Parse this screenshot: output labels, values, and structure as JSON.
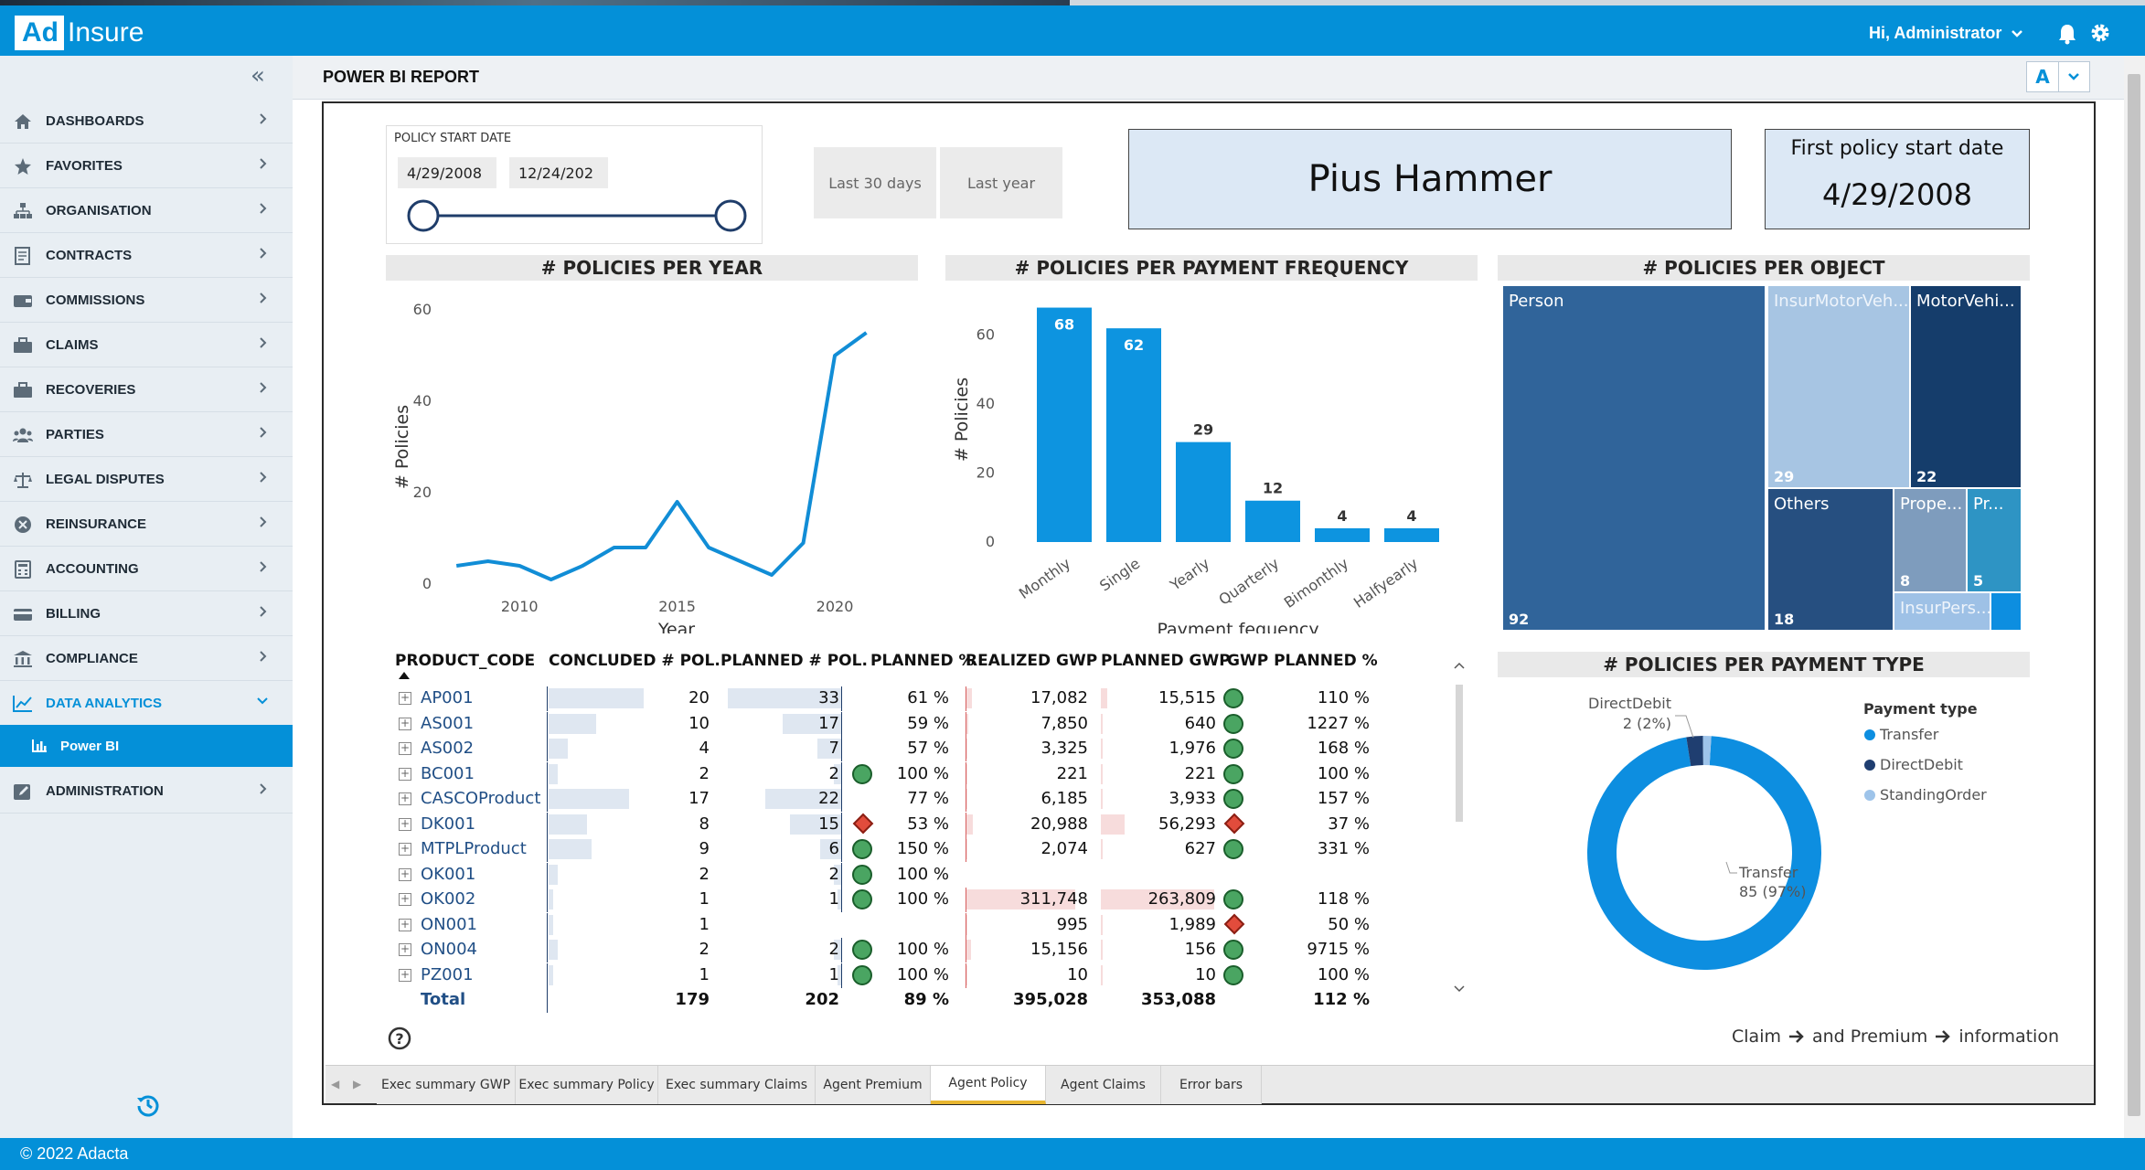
{
  "app": {
    "logo_a": "Ad",
    "logo_b": "Insure",
    "user_greeting": "Hi, Administrator",
    "footer": "© 2022 Adacta"
  },
  "sidebar": {
    "items": [
      {
        "label": "DASHBOARDS",
        "icon": "home-icon"
      },
      {
        "label": "FAVORITES",
        "icon": "star-icon"
      },
      {
        "label": "ORGANISATION",
        "icon": "org-chart-icon"
      },
      {
        "label": "CONTRACTS",
        "icon": "contract-icon"
      },
      {
        "label": "COMMISSIONS",
        "icon": "wallet-icon"
      },
      {
        "label": "CLAIMS",
        "icon": "briefcase-icon"
      },
      {
        "label": "RECOVERIES",
        "icon": "briefcase-icon"
      },
      {
        "label": "PARTIES",
        "icon": "people-icon"
      },
      {
        "label": "LEGAL DISPUTES",
        "icon": "scale-icon"
      },
      {
        "label": "REINSURANCE",
        "icon": "x-circle-icon"
      },
      {
        "label": "ACCOUNTING",
        "icon": "calculator-icon"
      },
      {
        "label": "BILLING",
        "icon": "card-icon"
      },
      {
        "label": "COMPLIANCE",
        "icon": "bank-icon"
      },
      {
        "label": "DATA ANALYTICS",
        "icon": "chart-icon"
      },
      {
        "label": "ADMINISTRATION",
        "icon": "edit-icon"
      }
    ],
    "sub_item": "Power BI"
  },
  "header": {
    "title": "POWER BI REPORT",
    "lang": "A"
  },
  "report": {
    "slicer_title": "POLICY START DATE",
    "date_from": "4/29/2008",
    "date_to": "12/24/202",
    "btn_last30": "Last 30 days",
    "btn_lastyear": "Last year",
    "agent_name": "Pius Hammer",
    "first_policy_label": "First policy start date",
    "first_policy_value": "4/29/2008",
    "footnote_claim": "Claim",
    "footnote_premium": "and Premium",
    "footnote_info": "information",
    "tabs": [
      "Exec summary GWP",
      "Exec summary Policy",
      "Exec summary Claims",
      "Agent Premium",
      "Agent Policy",
      "Agent Claims",
      "Error bars"
    ],
    "active_tab": 4
  },
  "chart_data": [
    {
      "type": "line",
      "title": "# POLICIES PER YEAR",
      "xlabel": "Year",
      "ylabel": "# Policies",
      "x": [
        2008,
        2009,
        2010,
        2011,
        2012,
        2013,
        2014,
        2015,
        2016,
        2017,
        2018,
        2019,
        2020,
        2021
      ],
      "values": [
        4,
        5,
        4,
        1,
        4,
        8,
        8,
        18,
        8,
        5,
        2,
        9,
        50,
        55
      ],
      "xticks": [
        "2010",
        "2015",
        "2020"
      ],
      "yticks": [
        "0",
        "20",
        "40",
        "60"
      ],
      "ylim": [
        0,
        60
      ],
      "xlim": [
        2007.5,
        2022
      ],
      "color": "#118dd6"
    },
    {
      "type": "bar",
      "title": "# POLICIES PER PAYMENT FREQUENCY",
      "xlabel": "Payment fequency",
      "ylabel": "# Policies",
      "categories": [
        "Monthly",
        "Single",
        "Yearly",
        "Quarterly",
        "Bimonthly",
        "Halfyearly"
      ],
      "values": [
        68,
        62,
        29,
        12,
        4,
        4
      ],
      "yticks": [
        "0",
        "20",
        "40",
        "60"
      ],
      "ylim": [
        0,
        70
      ],
      "color": "#0d94e0"
    },
    {
      "type": "treemap",
      "title": "# POLICIES PER OBJECT",
      "items": [
        {
          "name": "Person",
          "value": 92,
          "color": "#30649a"
        },
        {
          "name": "InsurMotorVeh...",
          "value": 29,
          "color": "#a7c5e3"
        },
        {
          "name": "MotorVehi...",
          "value": 22,
          "color": "#153d6b"
        },
        {
          "name": "Others",
          "value": 18,
          "color": "#264f80"
        },
        {
          "name": "Prope...",
          "value": 8,
          "color": "#7e9cbd"
        },
        {
          "name": "Pr...",
          "value": 5,
          "color": "#2e94c4"
        },
        {
          "name": "InsurPers...",
          "value": null,
          "color": "#9ec1e6"
        },
        {
          "name": "",
          "value": null,
          "color": "#0d8ee0"
        }
      ]
    },
    {
      "type": "pie",
      "title": "# POLICIES PER PAYMENT TYPE",
      "legend_title": "Payment type",
      "slices": [
        {
          "name": "Transfer",
          "value": 85,
          "label": "85 (97%)",
          "color": "#0d8ee0"
        },
        {
          "name": "DirectDebit",
          "value": 2,
          "label": "2 (2%)",
          "color": "#1f3e70"
        },
        {
          "name": "StandingOrder",
          "value": 1,
          "label": "",
          "color": "#9ec4ea"
        }
      ]
    },
    {
      "type": "table",
      "columns": [
        "PRODUCT_CODE",
        "CONCLUDED # POL.",
        "PLANNED # POL.",
        "PLANNED %",
        "REALIZED GWP",
        "PLANNED GWP",
        "GWP PLANNED %"
      ],
      "rows": [
        {
          "code": "AP001",
          "concluded": "20",
          "planned": "33",
          "status": "",
          "pct": "61 %",
          "realized": "17,082",
          "pgwp": "15,515",
          "gstatus": "green",
          "gpct": "110 %"
        },
        {
          "code": "AS001",
          "concluded": "10",
          "planned": "17",
          "status": "",
          "pct": "59 %",
          "realized": "7,850",
          "pgwp": "640",
          "gstatus": "green",
          "gpct": "1227 %"
        },
        {
          "code": "AS002",
          "concluded": "4",
          "planned": "7",
          "status": "",
          "pct": "57 %",
          "realized": "3,325",
          "pgwp": "1,976",
          "gstatus": "green",
          "gpct": "168 %"
        },
        {
          "code": "BC001",
          "concluded": "2",
          "planned": "2",
          "status": "green",
          "pct": "100 %",
          "realized": "221",
          "pgwp": "221",
          "gstatus": "green",
          "gpct": "100 %"
        },
        {
          "code": "CASCOProduct",
          "concluded": "17",
          "planned": "22",
          "status": "",
          "pct": "77 %",
          "realized": "6,185",
          "pgwp": "3,933",
          "gstatus": "green",
          "gpct": "157 %"
        },
        {
          "code": "DK001",
          "concluded": "8",
          "planned": "15",
          "status": "red",
          "pct": "53 %",
          "realized": "20,988",
          "pgwp": "56,293",
          "gstatus": "red",
          "gpct": "37 %"
        },
        {
          "code": "MTPLProduct",
          "concluded": "9",
          "planned": "6",
          "status": "green",
          "pct": "150 %",
          "realized": "2,074",
          "pgwp": "627",
          "gstatus": "green",
          "gpct": "331 %"
        },
        {
          "code": "OK001",
          "concluded": "2",
          "planned": "2",
          "status": "green",
          "pct": "100 %",
          "realized": "",
          "pgwp": "",
          "gstatus": "",
          "gpct": ""
        },
        {
          "code": "OK002",
          "concluded": "1",
          "planned": "1",
          "status": "green",
          "pct": "100 %",
          "realized": "311,748",
          "pgwp": "263,809",
          "gstatus": "green",
          "gpct": "118 %"
        },
        {
          "code": "ON001",
          "concluded": "1",
          "planned": "",
          "status": "",
          "pct": "",
          "realized": "995",
          "pgwp": "1,989",
          "gstatus": "red",
          "gpct": "50 %"
        },
        {
          "code": "ON004",
          "concluded": "2",
          "planned": "2",
          "status": "green",
          "pct": "100 %",
          "realized": "15,156",
          "pgwp": "156",
          "gstatus": "green",
          "gpct": "9715 %"
        },
        {
          "code": "PZ001",
          "concluded": "1",
          "planned": "1",
          "status": "green",
          "pct": "100 %",
          "realized": "10",
          "pgwp": "10",
          "gstatus": "green",
          "gpct": "100 %"
        }
      ],
      "total": {
        "label": "Total",
        "concluded": "179",
        "planned": "202",
        "pct": "89 %",
        "realized": "395,028",
        "pgwp": "353,088",
        "gpct": "112 %"
      }
    }
  ]
}
